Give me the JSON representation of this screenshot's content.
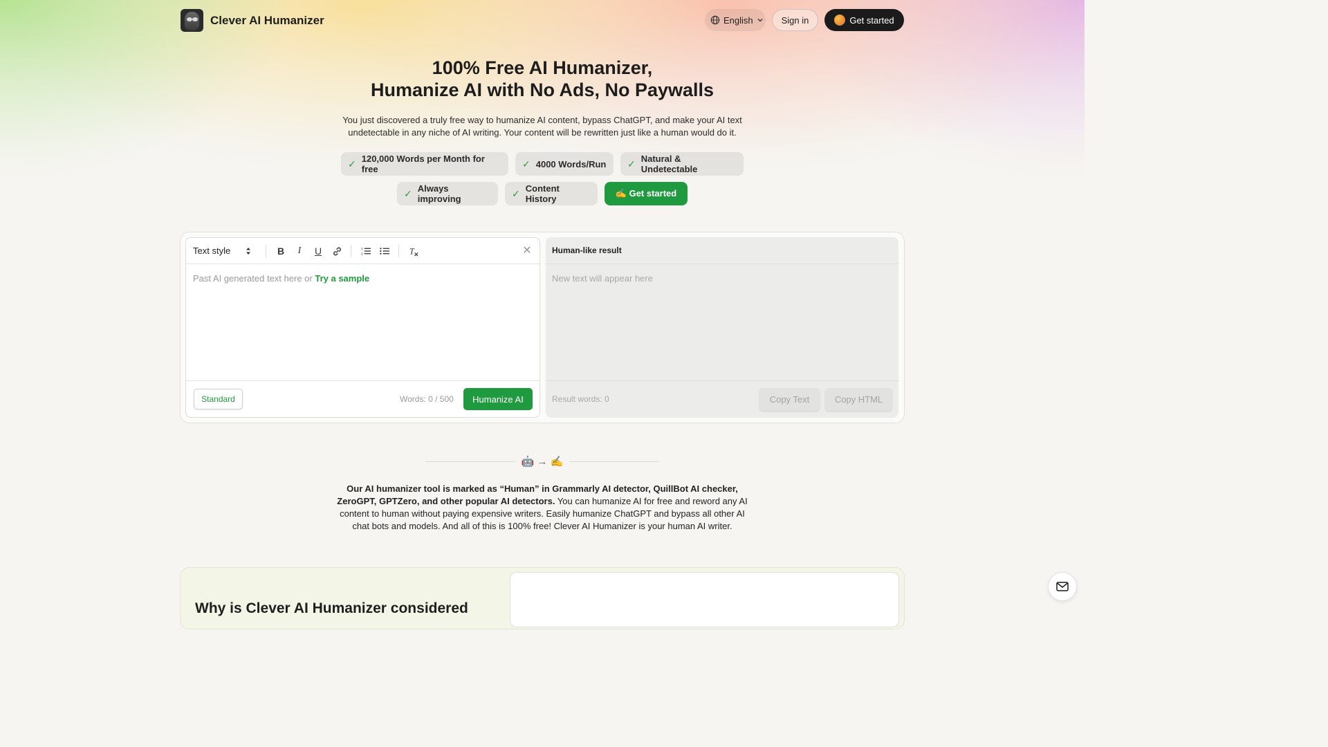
{
  "header": {
    "brand": "Clever AI Humanizer",
    "language": "English",
    "sign_in": "Sign in",
    "get_started": "Get started"
  },
  "hero": {
    "title_line1": "100% Free AI Humanizer,",
    "title_line2": "Humanize AI with No Ads, No Paywalls",
    "subtitle": "You just discovered a truly free way to humanize AI content, bypass ChatGPT, and make your AI text undetectable in any niche of AI writing. Your content will be rewritten just like a human would do it.",
    "features": [
      "120,000 Words per Month for free",
      "4000 Words/Run",
      "Natural & Undetectable",
      "Always improving",
      "Content History"
    ],
    "cta": "✍️ Get started"
  },
  "editor": {
    "text_style": "Text style",
    "placeholder": "Past AI generated text here or",
    "try_sample": "Try a sample",
    "mode": "Standard",
    "word_count": "Words: 0 / 500",
    "humanize": "Humanize AI"
  },
  "result": {
    "title": "Human-like result",
    "placeholder": "New text will appear here",
    "word_count": "Result words: 0",
    "copy_text": "Copy Text",
    "copy_html": "Copy HTML"
  },
  "divider_emoji": "🤖 → ✍️",
  "description": {
    "bold": "Our AI humanizer tool is marked as “Human” in Grammarly AI detector, QuillBot AI checker, ZeroGPT, GPTZero, and other popular AI detectors.",
    "rest": " You can humanize AI for free and reword any AI content to human without paying expensive writers. Easily humanize ChatGPT and bypass all other AI chat bots and models. And all of this is 100% free! Clever AI Humanizer is your human AI writer."
  },
  "bottom": {
    "heading": "Why is Clever AI Humanizer considered"
  },
  "colors": {
    "accent": "#1f9a3e",
    "dark_button": "#1b1b1b",
    "page_bg": "#f6f5f1"
  }
}
